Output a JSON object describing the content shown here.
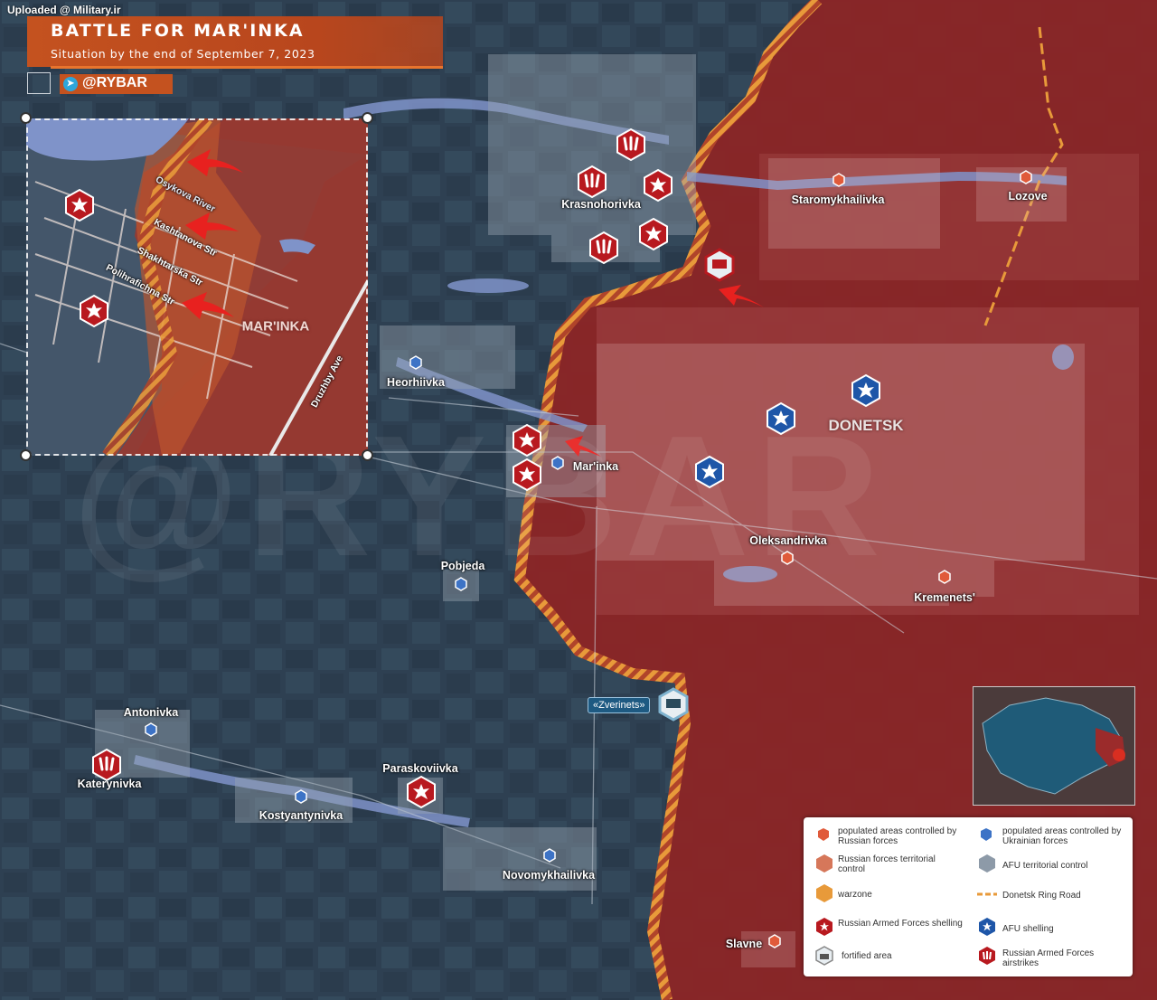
{
  "header": {
    "upload_note": "Uploaded @ Military.ir",
    "title": "BATTLE FOR MAR'INKA",
    "subtitle": "Situation by the end of September 7, 2023",
    "brand": "@RYBAR"
  },
  "watermark": "@RYBAR",
  "places": {
    "staromykhailivka": "Staromykhailivka",
    "lozove": "Lozove",
    "krasnohorivka": "Krasnohorivka",
    "heorhiivka": "Heorhiivka",
    "marinka": "Mar'inka",
    "donetsk": "DONETSK",
    "oleksandrivka": "Oleksandrivka",
    "kremenets": "Kremenets'",
    "pobjeda": "Pobjeda",
    "zverinets": "«Zverinets»",
    "antonivka": "Antonivka",
    "katerynivka": "Katerynivka",
    "paraskoviivka": "Paraskoviivka",
    "kostyantynivka": "Kostyantynivka",
    "novomykhailivka": "Novomykhailivka",
    "slavne": "Slavne"
  },
  "inset": {
    "town": "MAR'INKA",
    "river": "Osykova River",
    "streets": [
      "Kashtanova Str",
      "Shakhtarska Str",
      "Polihrafichna Str",
      "Druzhby Ave"
    ]
  },
  "legend": {
    "ru_populated": "populated areas controlled by Russian forces",
    "ua_populated": "populated areas controlled by Ukrainian forces",
    "ru_territory": "Russian forces territorial control",
    "afu_territory": "AFU territorial control",
    "warzone": "warzone",
    "ring_road": "Donetsk Ring Road",
    "ru_shelling": "Russian Armed Forces shelling",
    "afu_shelling": "AFU shelling",
    "fortified": "fortified area",
    "ru_airstrikes": "Russian Armed Forces airstrikes"
  },
  "colors": {
    "russian_control": "#8e2525",
    "ukrainian_land": "#2f4154",
    "warzone": "#e89a3a",
    "ru_symbol": "#b8191f",
    "afu_symbol": "#1e56a8",
    "ring_road": "#e89a3a",
    "water": "#7f93c9"
  },
  "icons": {
    "shelling": "explosion-icon",
    "airstrike": "airstrike-icon",
    "fortified": "fortification-icon",
    "ru_pin": "red-hexagon-pin-icon",
    "ua_pin": "blue-hexagon-pin-icon",
    "attack": "red-arrow-icon",
    "telegram": "telegram-icon"
  }
}
